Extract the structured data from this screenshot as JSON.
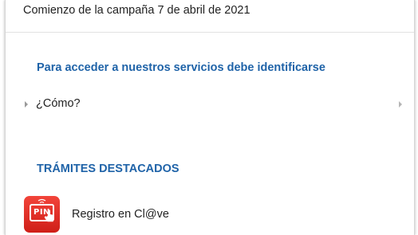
{
  "campaign": {
    "text": "Comienzo de la campaña 7 de abril de 2021"
  },
  "identify": {
    "heading": "Para acceder a nuestros servicios debe identificarse",
    "how_link": "¿Cómo?"
  },
  "tramites": {
    "heading": "TRÁMITES DESTACADOS",
    "items": [
      {
        "label": "Registro en Cl@ve",
        "icon": "pin-icon",
        "icon_text": "PIN"
      }
    ]
  },
  "colors": {
    "heading": "#1f63a8",
    "text": "#222222",
    "icon_red": "#e0342b"
  }
}
